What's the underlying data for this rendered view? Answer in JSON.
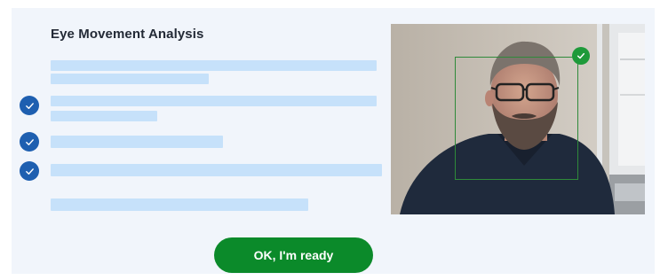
{
  "panel": {
    "title": "Eye Movement Analysis",
    "instructions": [
      {
        "checked": false
      },
      {
        "checked": true
      },
      {
        "checked": true
      },
      {
        "checked": true
      },
      {
        "checked": false
      }
    ]
  },
  "camera": {
    "face_detected": true,
    "icons": [
      "face-box",
      "check-icon"
    ]
  },
  "footer": {
    "ok_button_label": "OK, I'm ready"
  },
  "colors": {
    "panel_background": "#f1f5fb",
    "placeholder_bar": "#c6e1fa",
    "check_badge": "#1e5fb0",
    "face_box": "#2f8a3a",
    "primary_button": "#0b8a2a"
  }
}
